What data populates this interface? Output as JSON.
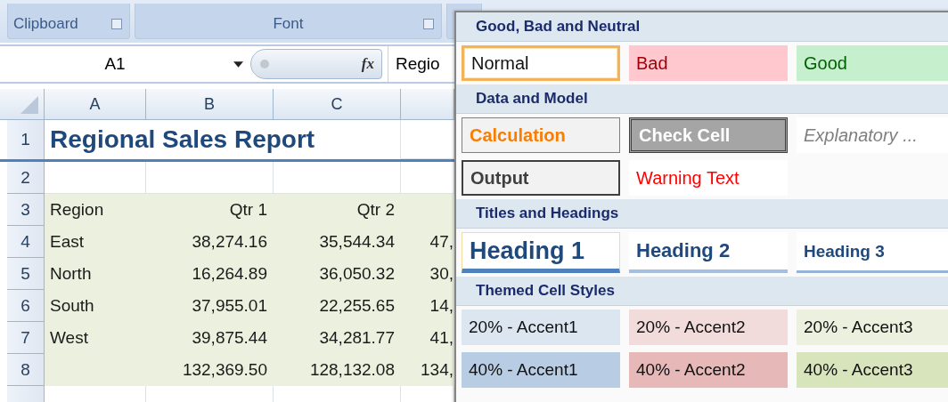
{
  "ribbon": {
    "groups": [
      {
        "label": "Clipboard",
        "launcher": true
      },
      {
        "label": "Font",
        "launcher": true
      }
    ]
  },
  "formula_bar": {
    "name_box": "A1",
    "function_icon": "fx",
    "value": "Regio"
  },
  "sheet": {
    "columns": [
      "A",
      "B",
      "C"
    ],
    "rows": [
      {
        "number": "1",
        "kind": "title",
        "cells": [
          "Regional Sales Report",
          "",
          "",
          ""
        ]
      },
      {
        "number": "2",
        "kind": "blank",
        "cells": [
          "",
          "",
          "",
          ""
        ]
      },
      {
        "number": "3",
        "kind": "data",
        "cells": [
          "Region",
          "Qtr 1",
          "Qtr 2",
          ""
        ]
      },
      {
        "number": "4",
        "kind": "data",
        "cells": [
          "East",
          "38,274.16",
          "35,544.34",
          "47,"
        ]
      },
      {
        "number": "5",
        "kind": "data",
        "cells": [
          "North",
          "16,264.89",
          "36,050.32",
          "30,"
        ]
      },
      {
        "number": "6",
        "kind": "data",
        "cells": [
          "South",
          "37,955.01",
          "22,255.65",
          "14,"
        ]
      },
      {
        "number": "7",
        "kind": "data",
        "cells": [
          "West",
          "39,875.44",
          "34,281.77",
          "41,"
        ]
      },
      {
        "number": "8",
        "kind": "data",
        "cells": [
          "",
          "132,369.50",
          "128,132.08",
          "134,"
        ]
      }
    ]
  },
  "style_gallery": {
    "sections": [
      {
        "title": "Good, Bad and Neutral",
        "rows": [
          [
            {
              "label": "Normal",
              "kind": "normal",
              "selected": true
            },
            {
              "label": "Bad",
              "kind": "bad",
              "selected": false
            },
            {
              "label": "Good",
              "kind": "good",
              "selected": false
            }
          ]
        ]
      },
      {
        "title": "Data and Model",
        "rows": [
          [
            {
              "label": "Calculation",
              "kind": "calculation",
              "selected": false
            },
            {
              "label": "Check Cell",
              "kind": "check",
              "selected": false
            },
            {
              "label": "Explanatory ...",
              "kind": "explanatory",
              "selected": false
            }
          ],
          [
            {
              "label": "Output",
              "kind": "output",
              "selected": false
            },
            {
              "label": "Warning Text",
              "kind": "warning",
              "selected": false
            }
          ]
        ]
      },
      {
        "title": "Titles and Headings",
        "rows": [
          [
            {
              "label": "Heading 1",
              "kind": "heading1",
              "selected": false
            },
            {
              "label": "Heading 2",
              "kind": "heading2",
              "selected": false
            },
            {
              "label": "Heading 3",
              "kind": "heading3",
              "selected": false
            }
          ]
        ]
      },
      {
        "title": "Themed Cell Styles",
        "rows": [
          [
            {
              "label": "20% - Accent1",
              "kind": "accent",
              "color": "#dce6f1",
              "selected": false
            },
            {
              "label": "20% - Accent2",
              "kind": "accent",
              "color": "#f2dcdb",
              "selected": false
            },
            {
              "label": "20% - Accent3",
              "kind": "accent",
              "color": "#ebf1de",
              "selected": false
            }
          ],
          [
            {
              "label": "40% - Accent1",
              "kind": "accent",
              "color": "#b8cce4",
              "selected": false
            },
            {
              "label": "40% - Accent2",
              "kind": "accent",
              "color": "#e6b8b7",
              "selected": false
            },
            {
              "label": "40% - Accent3",
              "kind": "accent",
              "color": "#d8e4bc",
              "selected": false
            }
          ]
        ]
      }
    ]
  }
}
